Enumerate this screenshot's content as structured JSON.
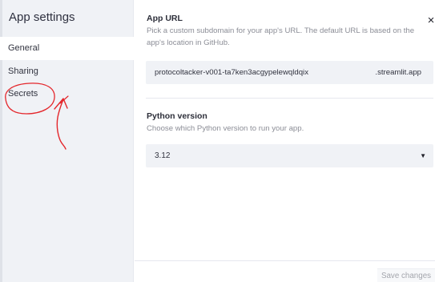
{
  "dialog": {
    "title": "App settings",
    "close_icon": "close-icon"
  },
  "sidebar": {
    "items": [
      {
        "label": "General",
        "active": true
      },
      {
        "label": "Sharing",
        "active": false
      },
      {
        "label": "Secrets",
        "active": false
      }
    ],
    "annotation": {
      "target": "Secrets",
      "color": "#e4262b",
      "marks": [
        "circle",
        "arrow"
      ]
    }
  },
  "main": {
    "app_url": {
      "label": "App URL",
      "help": "Pick a custom subdomain for your app's URL. The default URL is based on the app's location in GitHub.",
      "subdomain_value": "protocoltacker-v001-ta7ken3acgypelewqldqix",
      "domain_suffix": ".streamlit.app"
    },
    "python_version": {
      "label": "Python version",
      "help": "Choose which Python version to run your app.",
      "selected": "3.12",
      "dropdown_icon": "chevron-down-icon"
    }
  },
  "footer": {
    "save_label": "Save changes"
  },
  "colors": {
    "sidebar_background": "#f0f2f6",
    "field_background": "#f0f2f6",
    "annotation_red": "#e4262b",
    "muted_text": "#8b8d96"
  }
}
